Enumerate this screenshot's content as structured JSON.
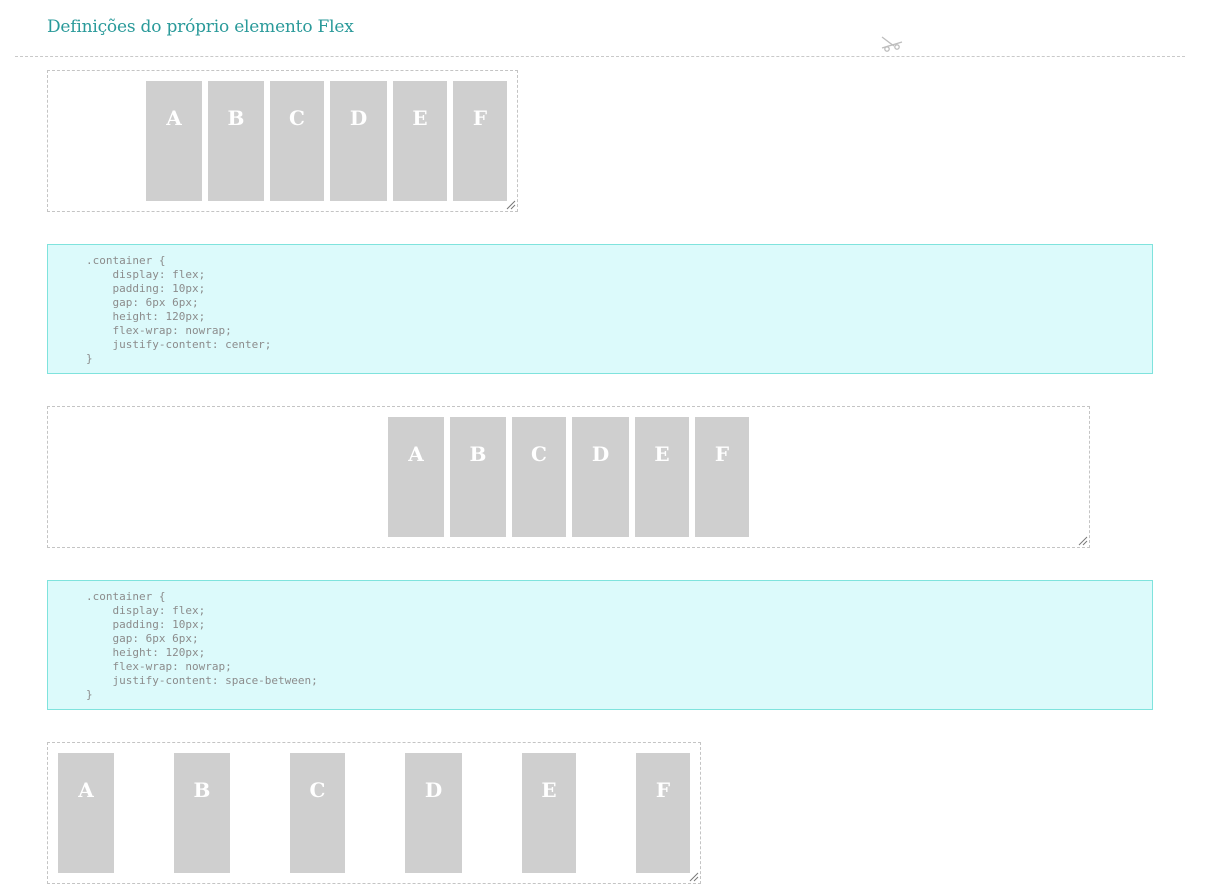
{
  "header": {
    "title": "Definições do próprio elemento Flex",
    "scissors_icon": "scissors-icon"
  },
  "demos": [
    {
      "items": [
        "A",
        "B",
        "C",
        "D",
        "E",
        "F"
      ]
    },
    {
      "items": [
        "A",
        "B",
        "C",
        "D",
        "E",
        "F"
      ]
    },
    {
      "items": [
        "A",
        "B",
        "C",
        "D",
        "E",
        "F"
      ]
    }
  ],
  "code_blocks": [
    {
      "text": ".container {\n    display: flex;\n    padding: 10px;\n    gap: 6px 6px;\n    height: 120px;\n    flex-wrap: nowrap;\n    justify-content: center;\n}"
    },
    {
      "text": ".container {\n    display: flex;\n    padding: 10px;\n    gap: 6px 6px;\n    height: 120px;\n    flex-wrap: nowrap;\n    justify-content: space-between;\n}"
    }
  ],
  "colors": {
    "title": "#2a9a9a",
    "item_bg": "#cfcfcf",
    "code_bg": "#dcfafb",
    "code_border": "#7fe3dd"
  }
}
